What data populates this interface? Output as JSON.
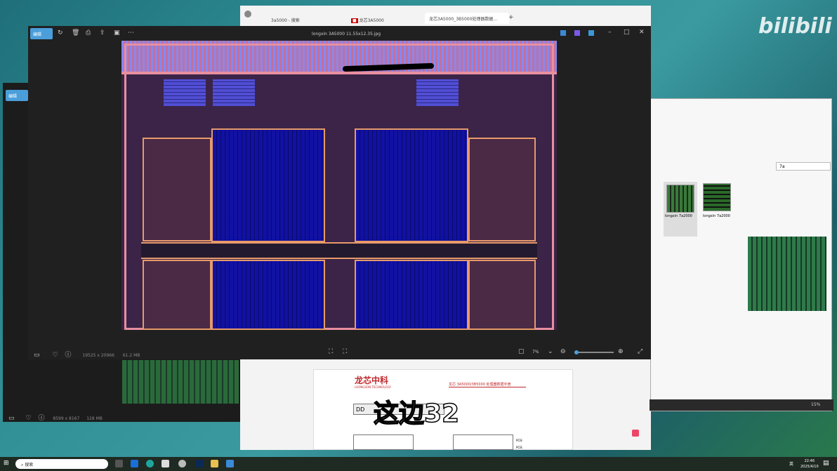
{
  "browser": {
    "tabs": [
      {
        "label": "3a5000 - 搜索"
      },
      {
        "label": "龙芯3A5000"
      },
      {
        "label": "龙芯3A5000_3B5000处理器数据..."
      }
    ],
    "new_tab": "+"
  },
  "viewer_front": {
    "edit_label": "编辑",
    "title": "longxin 3A5000 11.55x12.35.jpg",
    "dimensions": "19525 x 20966",
    "file_size": "61.2 MB",
    "zoom": "7%",
    "zoom_level_percent": 7
  },
  "viewer_back": {
    "edit_label": "编辑",
    "dimensions": "8599 x 8167",
    "file_size": "128 MB"
  },
  "explorer": {
    "search_value": "7a",
    "items": [
      {
        "label": "longxin 7a2000"
      },
      {
        "label": "longxin 7a2000"
      }
    ],
    "zoom": "15%"
  },
  "pdf": {
    "logo_cn": "龙芯中科",
    "logo_en": "LOONGSON TECHNOLOGY",
    "header": "龙芯 3A5000/3B5000 处理器数据手册",
    "box_label": "DD",
    "pcie_1": "PCIE",
    "pcie_2": "PCIE"
  },
  "subtitle": "这边32",
  "watermark": "bilibili",
  "taskbar": {
    "search_placeholder": "搜索",
    "time": "22:46",
    "date": "2025/4/10",
    "ime": "英"
  },
  "colors": {
    "accent": "#4a9eda",
    "chip_blue": "#4a4ad8",
    "chip_border": "#e79a6a"
  }
}
